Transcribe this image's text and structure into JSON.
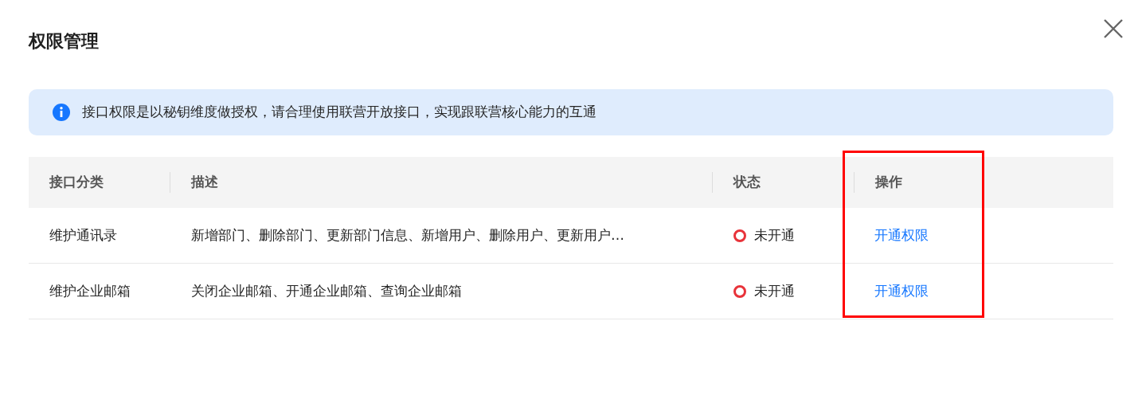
{
  "dialog": {
    "title": "权限管理"
  },
  "notice": {
    "text": "接口权限是以秘钥维度做授权，请合理使用联营开放接口，实现跟联营核心能力的互通"
  },
  "table": {
    "columns": [
      {
        "label": "接口分类"
      },
      {
        "label": "描述"
      },
      {
        "label": "状态"
      },
      {
        "label": "操作"
      }
    ],
    "rows": [
      {
        "category": "维护通讯录",
        "description": "新增部门、删除部门、更新部门信息、新增用户、删除用户、更新用户…",
        "status": {
          "text": "未开通",
          "kind": "inactive"
        },
        "action": "开通权限"
      },
      {
        "category": "维护企业邮箱",
        "description": "关闭企业邮箱、开通企业邮箱、查询企业邮箱",
        "status": {
          "text": "未开通",
          "kind": "inactive"
        },
        "action": "开通权限"
      }
    ]
  },
  "annotation": {
    "kind": "highlight-frame"
  }
}
